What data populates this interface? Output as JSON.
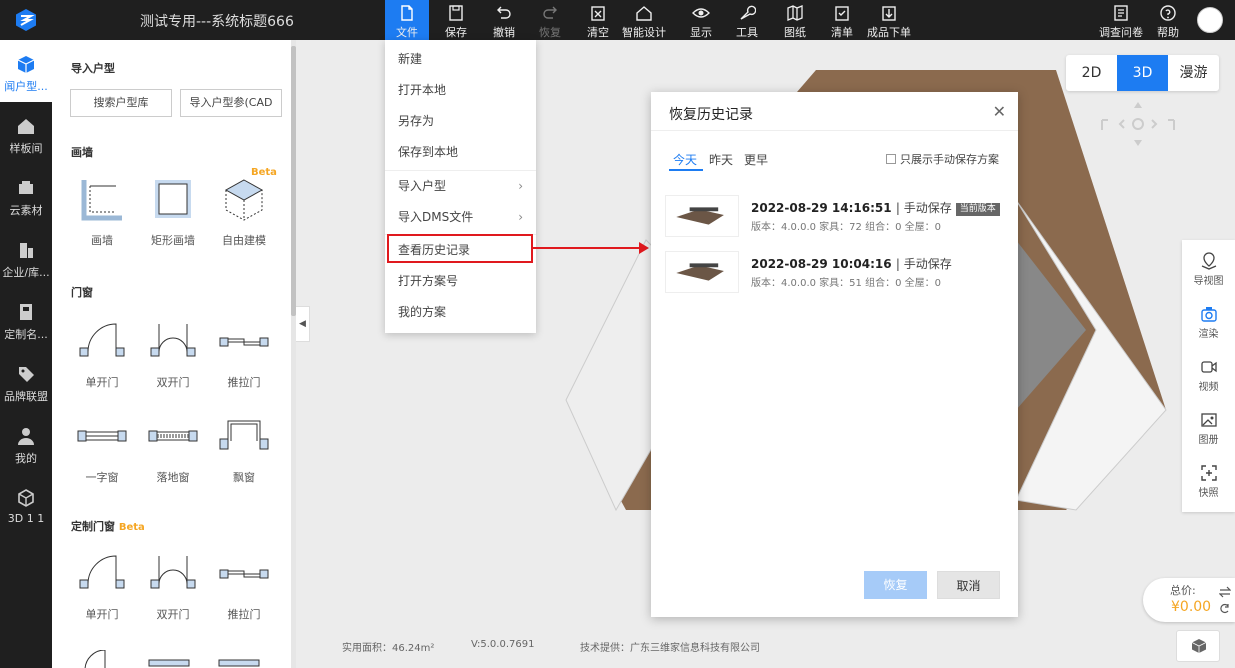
{
  "app": {
    "title": "测试专用---系统标题666"
  },
  "toolbar": [
    {
      "label": "文件",
      "icon": "file-icon",
      "active": true
    },
    {
      "label": "保存",
      "icon": "save-icon"
    },
    {
      "label": "撤销",
      "icon": "undo-icon"
    },
    {
      "label": "恢复",
      "icon": "redo-icon",
      "disabled": true
    },
    {
      "label": "清空",
      "icon": "clear-icon"
    },
    {
      "label": "智能设计",
      "icon": "smart-design-icon"
    },
    {
      "label": "显示",
      "icon": "eye-icon"
    },
    {
      "label": "工具",
      "icon": "wrench-icon"
    },
    {
      "label": "图纸",
      "icon": "drawing-icon"
    },
    {
      "label": "清单",
      "icon": "checklist-icon"
    },
    {
      "label": "成品下单",
      "icon": "order-icon"
    }
  ],
  "toolbar_right": [
    {
      "label": "调查问卷",
      "icon": "survey-icon"
    },
    {
      "label": "帮助",
      "icon": "help-icon"
    }
  ],
  "leftnav": [
    {
      "label": "闻户型...",
      "icon": "floorplan-icon",
      "active": true
    },
    {
      "label": "样板间",
      "icon": "house-icon"
    },
    {
      "label": "云素材",
      "icon": "cloud-material-icon"
    },
    {
      "label": "企业/库...",
      "icon": "enterprise-icon"
    },
    {
      "label": "定制名...",
      "icon": "custom-icon"
    },
    {
      "label": "品牌联盟",
      "icon": "tag-icon"
    },
    {
      "label": "我的",
      "icon": "user-icon"
    },
    {
      "label": "3D 1 1",
      "icon": "3d-icon"
    }
  ],
  "panel": {
    "import_title": "导入户型",
    "search_btn": "搜索户型库",
    "import_btn": "导入户型参(CAD",
    "walls_title": "画墙",
    "walls": [
      {
        "label": "画墙"
      },
      {
        "label": "矩形画墙"
      },
      {
        "label": "自由建模"
      }
    ],
    "beta": "Beta",
    "doors_title": "门窗",
    "doors": [
      {
        "label": "单开门"
      },
      {
        "label": "双开门"
      },
      {
        "label": "推拉门"
      },
      {
        "label": "一字窗"
      },
      {
        "label": "落地窗"
      },
      {
        "label": "飘窗"
      }
    ],
    "custom_title": "定制门窗",
    "custom": [
      {
        "label": "单开门"
      },
      {
        "label": "双开门"
      },
      {
        "label": "推拉门"
      }
    ]
  },
  "file_menu": [
    {
      "label": "新建"
    },
    {
      "label": "打开本地"
    },
    {
      "label": "另存为"
    },
    {
      "label": "保存到本地"
    },
    {
      "label": "导入户型",
      "submenu": true
    },
    {
      "label": "导入DMS文件",
      "submenu": true
    },
    {
      "label": "查看历史记录",
      "highlight": true
    },
    {
      "label": "打开方案号"
    },
    {
      "label": "我的方案"
    }
  ],
  "view_toggle": {
    "mode_2d": "2D",
    "mode_3d": "3D",
    "mode_roam": "漫游",
    "active": "3D"
  },
  "right_panel": [
    {
      "label": "导视图",
      "icon": "map-pin-icon"
    },
    {
      "label": "渲染",
      "icon": "camera-icon"
    },
    {
      "label": "视频",
      "icon": "video-icon"
    },
    {
      "label": "图册",
      "icon": "album-icon"
    },
    {
      "label": "快照",
      "icon": "snapshot-icon"
    }
  ],
  "price": {
    "label": "总价:",
    "value": "¥0.00"
  },
  "status": {
    "area": "实用面积：46.24m²",
    "version": "V:5.0.0.7691",
    "support": "技术提供：广东三维家信息科技有限公司"
  },
  "dialog": {
    "title": "恢复历史记录",
    "tabs": [
      "今天",
      "昨天",
      "更早"
    ],
    "active_tab": "今天",
    "checkbox_label": "只展示手动保存方案",
    "records": [
      {
        "datetime": "2022-08-29 14:16:51",
        "type": "手动保存",
        "badge": "当前版本",
        "detail": "版本：4.0.0.0  家具：72 组合：0 全屋：0"
      },
      {
        "datetime": "2022-08-29 10:04:16",
        "type": "手动保存",
        "badge": "",
        "detail": "版本：4.0.0.0  家具：51 组合：0 全屋：0"
      }
    ],
    "restore_btn": "恢复",
    "cancel_btn": "取消"
  },
  "colors": {
    "accent": "#1d7cf2",
    "topbar": "#1f1f1f",
    "highlight": "#e0191e",
    "price": "#f5a623"
  }
}
